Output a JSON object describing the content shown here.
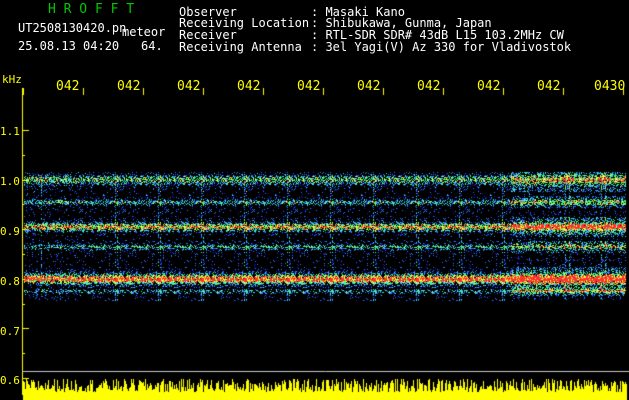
{
  "header": {
    "title": "H R O F F T",
    "filename": "UT2508130420.pn",
    "mode": "meteor",
    "datetime": "25.08.13 04:20",
    "number": "64.",
    "fields": [
      {
        "label": "Observer",
        "value": ": Masaki Kano"
      },
      {
        "label": "Receiving Location",
        "value": ": Shibukawa, Gunma, Japan"
      },
      {
        "label": "Receiver",
        "value": ": RTL-SDR SDR# 43dB L15 103.2MHz CW"
      },
      {
        "label": "Receiving Antenna",
        "value": ": 3el Yagi(V) Az 330 for Vladivostok"
      }
    ]
  },
  "axis": {
    "unit": "kHz",
    "x_ticks": [
      "042",
      "042",
      "042",
      "042",
      "042",
      "042",
      "042",
      "042",
      "042",
      "0430"
    ],
    "y_ticks": [
      "1.1",
      "1.0",
      "0.9",
      "0.8",
      "0.7",
      "0.6"
    ]
  },
  "colors": {
    "header_title": "#00c800",
    "header_text": "#ffffff",
    "axis": "#ffff00",
    "background": "#000000"
  }
}
